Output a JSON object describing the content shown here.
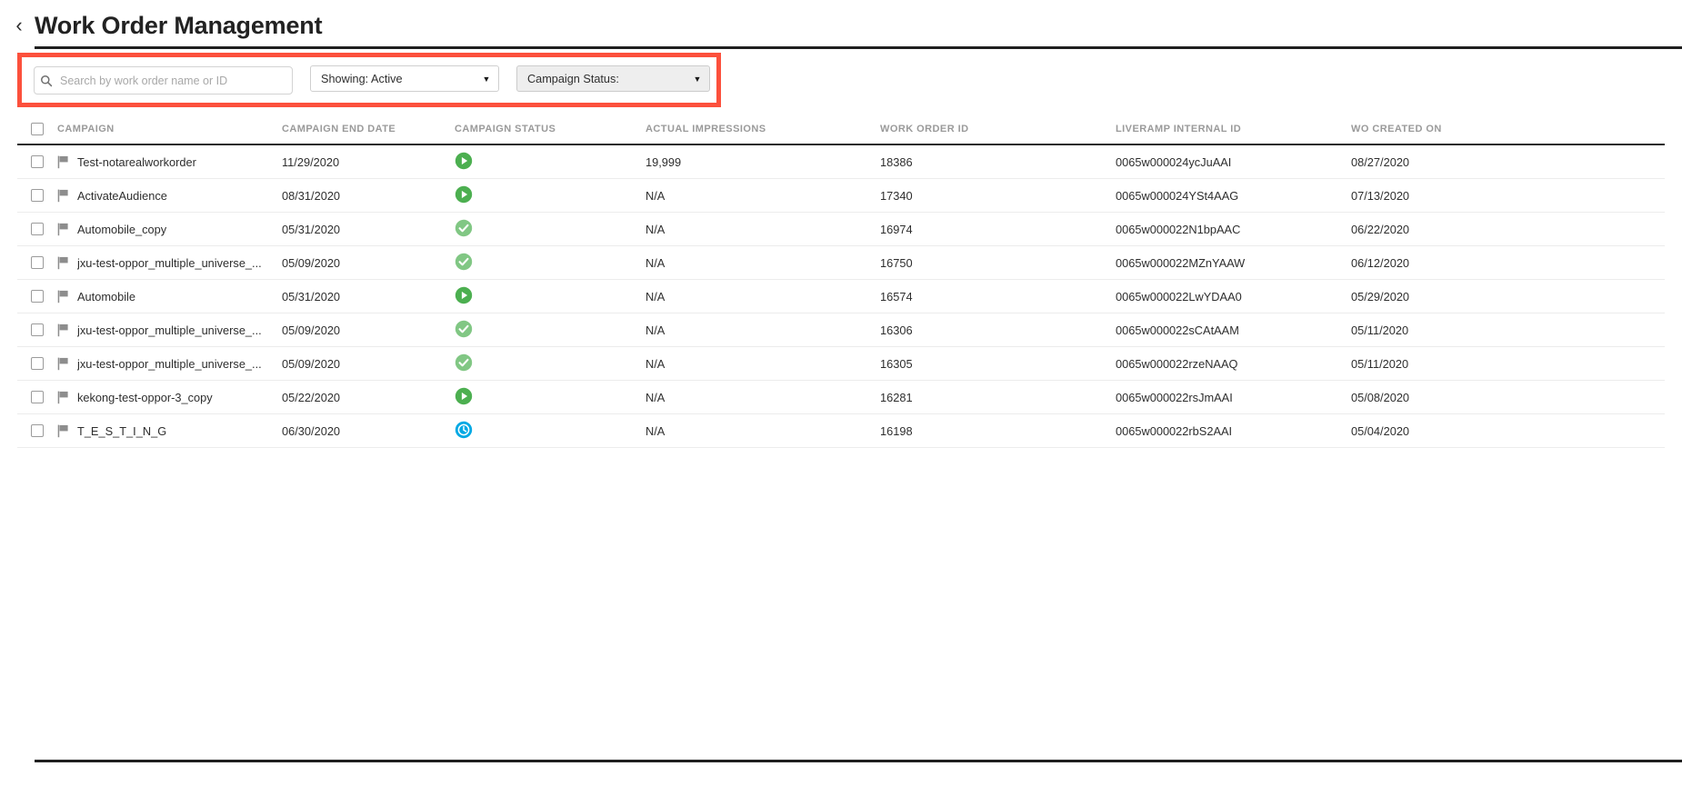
{
  "header": {
    "back_icon": "chevron-left-icon",
    "title": "Work Order Management"
  },
  "filters": {
    "search": {
      "icon": "search-icon",
      "placeholder": "Search by work order name or ID",
      "value": ""
    },
    "showing": {
      "label": "Showing: Active",
      "caret": "▼"
    },
    "campaign_status": {
      "label": "Campaign Status:",
      "caret": "▼"
    },
    "highlight_color": "#fc503c"
  },
  "table": {
    "columns": [
      "CAMPAIGN",
      "CAMPAIGN END DATE",
      "CAMPAIGN STATUS",
      "ACTUAL IMPRESSIONS",
      "WORK ORDER ID",
      "LIVERAMP INTERNAL ID",
      "WO CREATED ON"
    ],
    "status_colors": {
      "running": "#4caf50",
      "complete": "#81c784",
      "scheduled": "#03a9e4"
    },
    "rows": [
      {
        "campaign": "Test-notarealworkorder",
        "end_date": "11/29/2020",
        "status": "running",
        "impressions": "19,999",
        "work_order_id": "18386",
        "liveramp_internal_id": "0065w000024ycJuAAI",
        "created_on": "08/27/2020"
      },
      {
        "campaign": "ActivateAudience",
        "end_date": "08/31/2020",
        "status": "running",
        "impressions": "N/A",
        "work_order_id": "17340",
        "liveramp_internal_id": "0065w000024YSt4AAG",
        "created_on": "07/13/2020"
      },
      {
        "campaign": "Automobile_copy",
        "end_date": "05/31/2020",
        "status": "complete",
        "impressions": "N/A",
        "work_order_id": "16974",
        "liveramp_internal_id": "0065w000022N1bpAAC",
        "created_on": "06/22/2020"
      },
      {
        "campaign": "jxu-test-oppor_multiple_universe_...",
        "end_date": "05/09/2020",
        "status": "complete",
        "impressions": "N/A",
        "work_order_id": "16750",
        "liveramp_internal_id": "0065w000022MZnYAAW",
        "created_on": "06/12/2020"
      },
      {
        "campaign": "Automobile",
        "end_date": "05/31/2020",
        "status": "running",
        "impressions": "N/A",
        "work_order_id": "16574",
        "liveramp_internal_id": "0065w000022LwYDAA0",
        "created_on": "05/29/2020"
      },
      {
        "campaign": "jxu-test-oppor_multiple_universe_...",
        "end_date": "05/09/2020",
        "status": "complete",
        "impressions": "N/A",
        "work_order_id": "16306",
        "liveramp_internal_id": "0065w000022sCAtAAM",
        "created_on": "05/11/2020"
      },
      {
        "campaign": "jxu-test-oppor_multiple_universe_...",
        "end_date": "05/09/2020",
        "status": "complete",
        "impressions": "N/A",
        "work_order_id": "16305",
        "liveramp_internal_id": "0065w000022rzeNAAQ",
        "created_on": "05/11/2020"
      },
      {
        "campaign": "kekong-test-oppor-3_copy",
        "end_date": "05/22/2020",
        "status": "running",
        "impressions": "N/A",
        "work_order_id": "16281",
        "liveramp_internal_id": "0065w000022rsJmAAI",
        "created_on": "05/08/2020"
      },
      {
        "campaign": "T_E_S_T_I_N_G",
        "end_date": "06/30/2020",
        "status": "scheduled",
        "impressions": "N/A",
        "work_order_id": "16198",
        "liveramp_internal_id": "0065w000022rbS2AAI",
        "created_on": "05/04/2020"
      }
    ]
  }
}
